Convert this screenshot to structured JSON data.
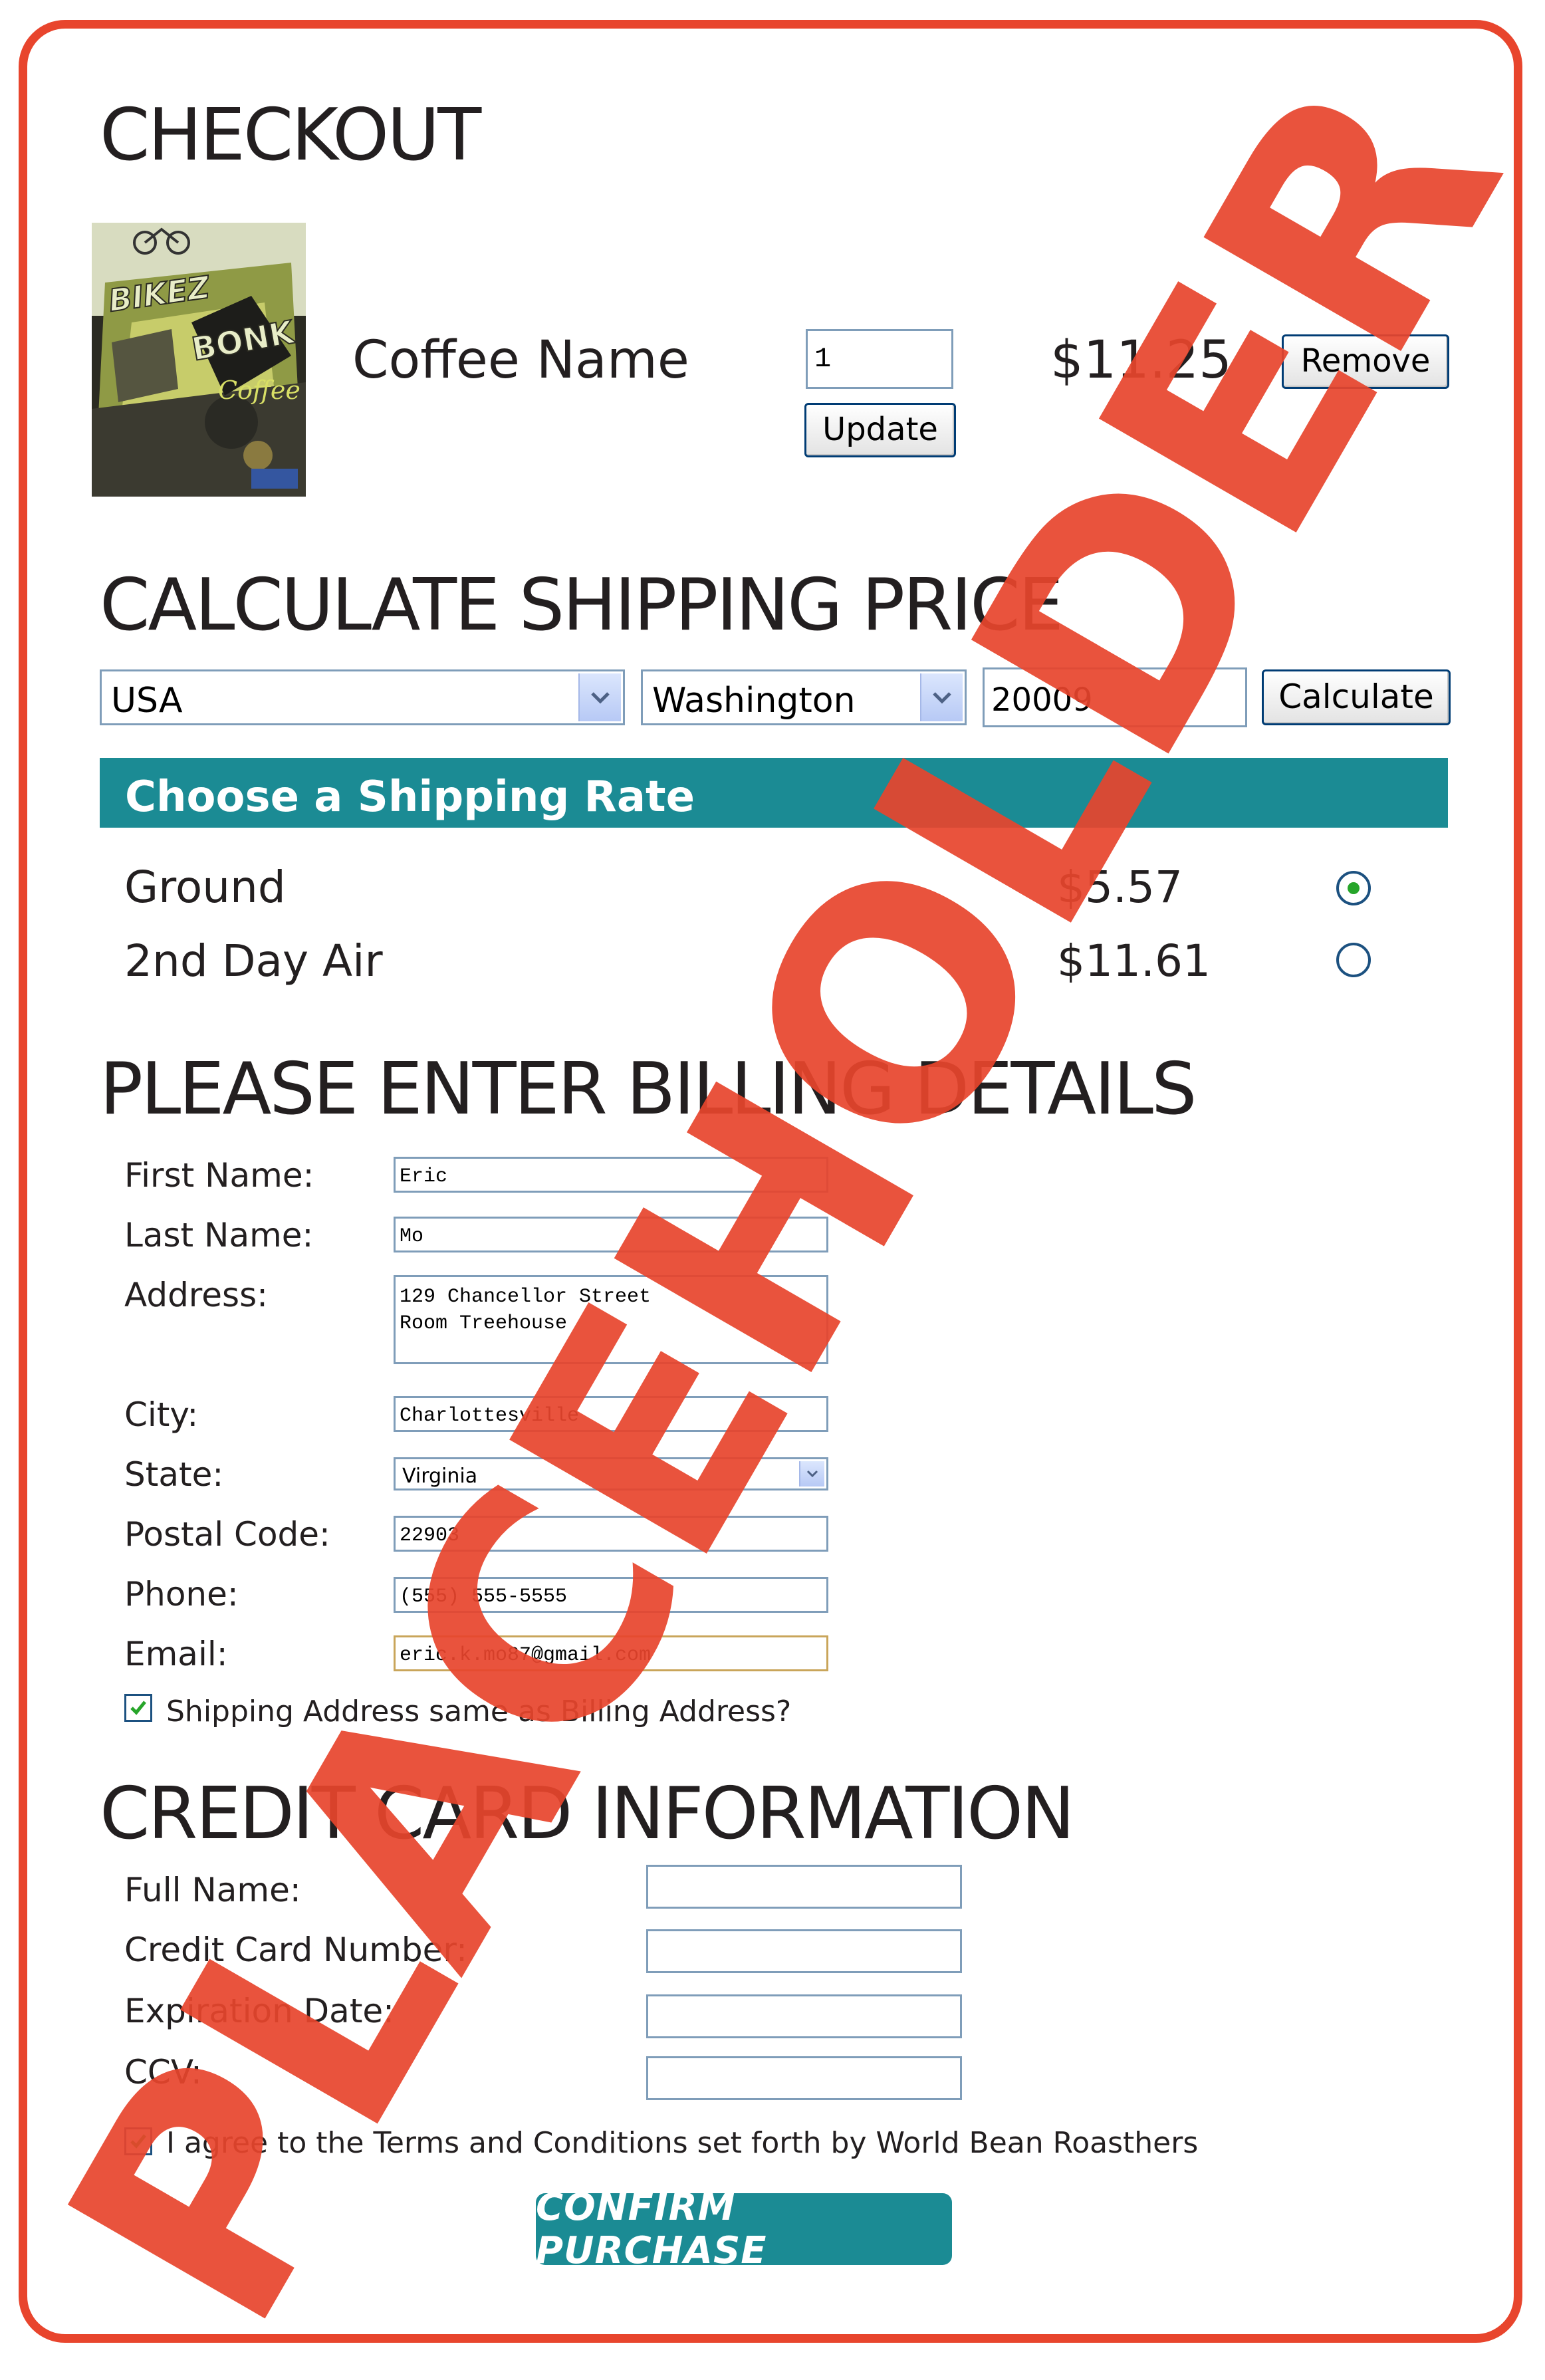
{
  "checkout": {
    "title": "CHECKOUT",
    "product_name": "Coffee Name",
    "quantity": "1",
    "update_label": "Update",
    "price": "$11.25",
    "remove_label": "Remove",
    "image_lettering": [
      "BIKEZ",
      "BONK",
      "Coffee"
    ]
  },
  "shipping_calc": {
    "title": "CALCULATE SHIPPING PRICE",
    "country": "USA",
    "state": "Washington",
    "zip": "20009",
    "calculate_label": "Calculate"
  },
  "shipping_rates": {
    "header": "Choose a Shipping Rate",
    "options": [
      {
        "name": "Ground",
        "price": "$5.57",
        "selected": true
      },
      {
        "name": "2nd Day Air",
        "price": "$11.61",
        "selected": false
      }
    ]
  },
  "billing": {
    "title": "PLEASE ENTER BILLING DETAILS",
    "labels": {
      "first_name": "First Name:",
      "last_name": "Last Name:",
      "address": "Address:",
      "city": "City:",
      "state": "State:",
      "postal_code": "Postal Code:",
      "phone": "Phone:",
      "email": "Email:"
    },
    "values": {
      "first_name": "Eric",
      "last_name": "Mo",
      "address_line1": "129 Chancellor Street",
      "address_line2": "Room Treehouse",
      "city": "Charlottesville",
      "state": "Virginia",
      "postal_code": "22903",
      "phone": "(555) 555-5555",
      "email": "eric.k.mo87@gmail.com"
    },
    "same_address_label": "Shipping Address same as Billing Address?",
    "same_address_checked": true
  },
  "credit_card": {
    "title": "CREDIT CARD INFORMATION",
    "labels": {
      "full_name": "Full Name:",
      "card_number": "Credit Card Number:",
      "expiration": "Expiration Date:",
      "ccv": "CCV:"
    },
    "terms_label": "I agree to the Terms and Conditions set forth by World Bean Roasthers",
    "terms_checked": true,
    "confirm_label": "CONFIRM PURCHASE"
  },
  "watermark": "PLACEHOLDER",
  "colors": {
    "accent_red": "#e8452d",
    "teal": "#1b8b94",
    "input_border": "#7f9db9"
  }
}
